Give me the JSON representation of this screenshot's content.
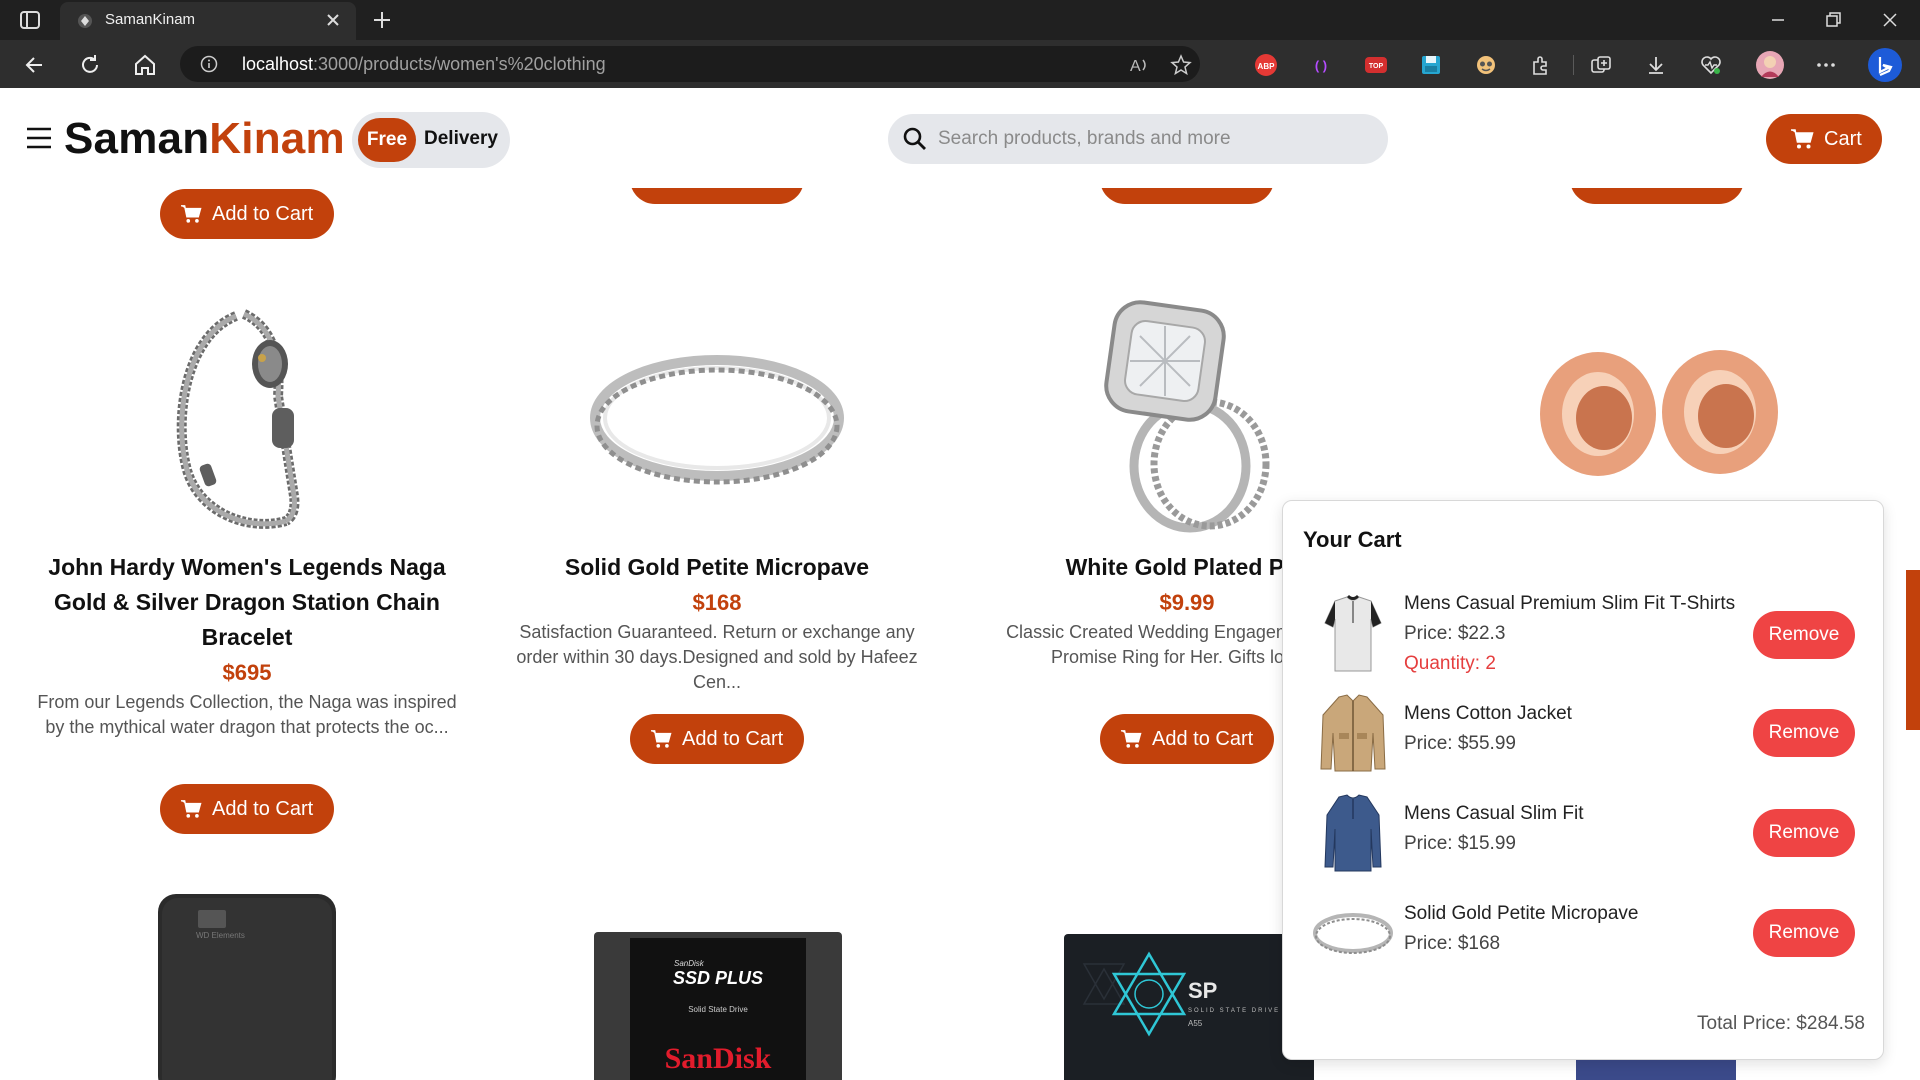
{
  "browser": {
    "tab_title": "SamanKinam",
    "url_host": "localhost",
    "url_path": ":3000/products/women's%20clothing",
    "icons": [
      "tab-actions-icon",
      "back-icon",
      "refresh-icon",
      "home-icon",
      "info-icon",
      "read-aloud-icon",
      "favorite-icon",
      "adblock-icon",
      "extension-icon",
      "extension-icon",
      "save-icon",
      "extension-icon",
      "extensions-icon",
      "split-screen-icon",
      "collections-icon",
      "downloads-icon",
      "performance-icon",
      "profile-avatar",
      "more-icon",
      "copilot-icon"
    ],
    "adblock_label": "ABP",
    "ext_label": "TOP"
  },
  "header": {
    "brand_part1": "Saman",
    "brand_part2": "Kinam",
    "free_label": "Free",
    "delivery_label": "Delivery",
    "search_placeholder": "Search products, brands and more",
    "cart_label": "Cart",
    "accent_color": "#c2410c"
  },
  "products": {
    "add_to_cart_label": "Add to Cart",
    "items": [
      {
        "title": "John Hardy Women's Legends Naga Gold & Silver Dragon Station Chain Bracelet",
        "price": "$695",
        "desc": "From our Legends Collection, the Naga was inspired by the mythical water dragon that protects the oc..."
      },
      {
        "title": "Solid Gold Petite Micropave",
        "price": "$168",
        "desc": "Satisfaction Guaranteed. Return or exchange any order within 30 days.Designed and sold by Hafeez Cen..."
      },
      {
        "title": "White Gold Plated Prir",
        "price": "$9.99",
        "desc": "Classic Created Wedding Engagem Diamond Promise Ring for Her. Gifts love ..."
      },
      {
        "title": "",
        "price": "",
        "desc": ""
      }
    ],
    "ssd_brand_small": "SanDisk",
    "ssd_title": "SSD PLUS",
    "ssd_sub": "Solid State Drive",
    "ssd_brand": "SanDisk",
    "sp_logo": "SP",
    "sp_sub": "SOLID STATE DRIVE",
    "sp_model": "A55",
    "wd_label": "WD Elements"
  },
  "cart": {
    "heading": "Your Cart",
    "items": [
      {
        "name": "Mens Casual Premium Slim Fit T-Shirts",
        "price": "Price: $22.3",
        "quantity": "Quantity: 2",
        "remove": "Remove"
      },
      {
        "name": "Mens Cotton Jacket",
        "price": "Price: $55.99",
        "remove": "Remove"
      },
      {
        "name": "Mens Casual Slim Fit",
        "price": "Price: $15.99",
        "remove": "Remove"
      },
      {
        "name": "Solid Gold Petite Micropave",
        "price": "Price: $168",
        "remove": "Remove"
      }
    ],
    "total": "Total Price: $284.58"
  }
}
